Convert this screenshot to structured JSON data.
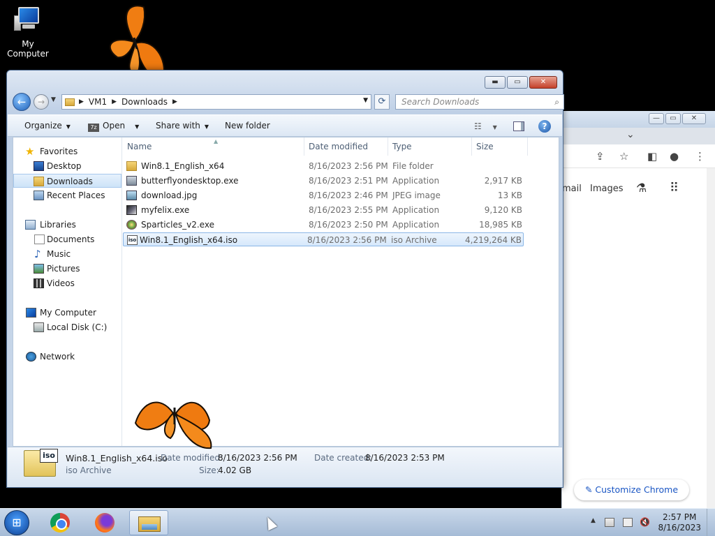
{
  "desktop": {
    "icon_label": "My Computer"
  },
  "explorer": {
    "breadcrumb": [
      "VM1",
      "Downloads"
    ],
    "search_placeholder": "Search Downloads",
    "toolbar": {
      "organize": "Organize",
      "open": "Open",
      "share_with": "Share with",
      "new_folder": "New folder"
    },
    "nav": {
      "favorites": "Favorites",
      "desktop": "Desktop",
      "downloads": "Downloads",
      "recent_places": "Recent Places",
      "libraries": "Libraries",
      "documents": "Documents",
      "music": "Music",
      "pictures": "Pictures",
      "videos": "Videos",
      "my_computer": "My Computer",
      "local_disk": "Local Disk (C:)",
      "network": "Network"
    },
    "columns": {
      "name": "Name",
      "date_modified": "Date modified",
      "type": "Type",
      "size": "Size"
    },
    "files": [
      {
        "name": "Win8.1_English_x64",
        "date": "8/16/2023 2:56 PM",
        "type": "File folder",
        "size": ""
      },
      {
        "name": "butterflyondesktop.exe",
        "date": "8/16/2023 2:51 PM",
        "type": "Application",
        "size": "2,917 KB"
      },
      {
        "name": "download.jpg",
        "date": "8/16/2023 2:46 PM",
        "type": "JPEG image",
        "size": "13 KB"
      },
      {
        "name": "myfelix.exe",
        "date": "8/16/2023 2:55 PM",
        "type": "Application",
        "size": "9,120 KB"
      },
      {
        "name": "Sparticles_v2.exe",
        "date": "8/16/2023 2:50 PM",
        "type": "Application",
        "size": "18,985 KB"
      },
      {
        "name": "Win8.1_English_x64.iso",
        "date": "8/16/2023 2:56 PM",
        "type": "iso Archive",
        "size": "4,219,264 KB"
      }
    ],
    "details": {
      "name": "Win8.1_English_x64.iso",
      "type": "iso Archive",
      "modified_label": "Date modified:",
      "modified_value": "8/16/2023 2:56 PM",
      "created_label": "Date created:",
      "created_value": "8/16/2023 2:53 PM",
      "size_label": "Size:",
      "size_value": "4.02 GB",
      "iso_tag": "iso"
    }
  },
  "chrome": {
    "gmail_partial": "mail",
    "images": "Images",
    "customize": "Customize Chrome"
  },
  "taskbar": {
    "time": "2:57 PM",
    "date": "8/16/2023"
  }
}
